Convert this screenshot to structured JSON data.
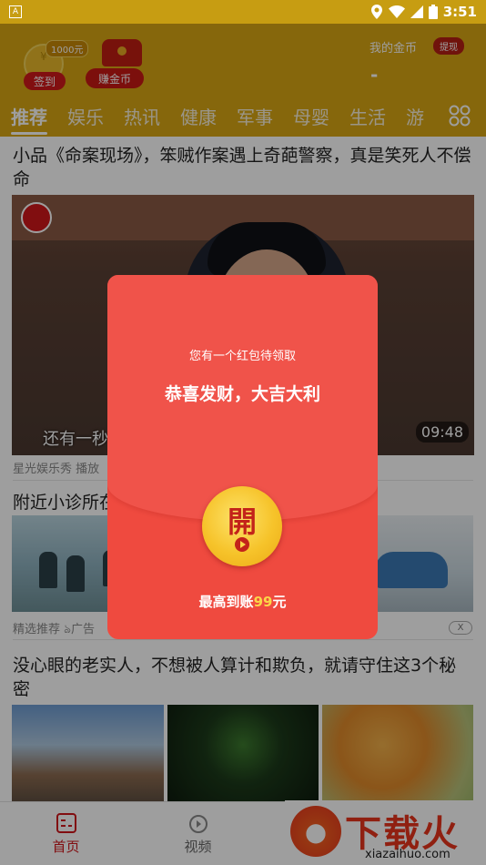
{
  "status_bar": {
    "time": "3:51",
    "app_letter": "A"
  },
  "header": {
    "signin_coins": "1000元",
    "signin_label": "签到",
    "earn_label": "赚金币",
    "mycoins_label": "我的金币",
    "withdraw_label": "提现",
    "coins_value": "-"
  },
  "tabs": [
    "推荐",
    "娱乐",
    "热讯",
    "健康",
    "军事",
    "母婴",
    "生活",
    "游"
  ],
  "feed": {
    "video": {
      "title": "小品《命案现场》，笨贼作案遇上奇葩警察，真是笑死人不偿命",
      "subtitle": "还有一秒",
      "duration": "09:48",
      "meta": "星光娱乐秀  播放"
    },
    "ad": {
      "title": "附近小诊所在",
      "meta": "精选推荐  ঌ广告",
      "close": "X"
    },
    "article": {
      "title": "没心眼的老实人，不想被人算计和欺负，就请守住这3个秘密"
    }
  },
  "bottom_nav": {
    "home": "首页",
    "video": "视频"
  },
  "watermark": {
    "big": "下载火",
    "small": "xiazaihuo.com"
  },
  "red_packet": {
    "pending": "您有一个红包待领取",
    "greeting": "恭喜发财，大吉大利",
    "open_label": "開",
    "max_prefix": "最高到账",
    "max_amount": "99",
    "max_suffix": "元"
  },
  "colors": {
    "header": "#d8a714",
    "red": "#ef4a3f",
    "gold": "#fbd748"
  }
}
